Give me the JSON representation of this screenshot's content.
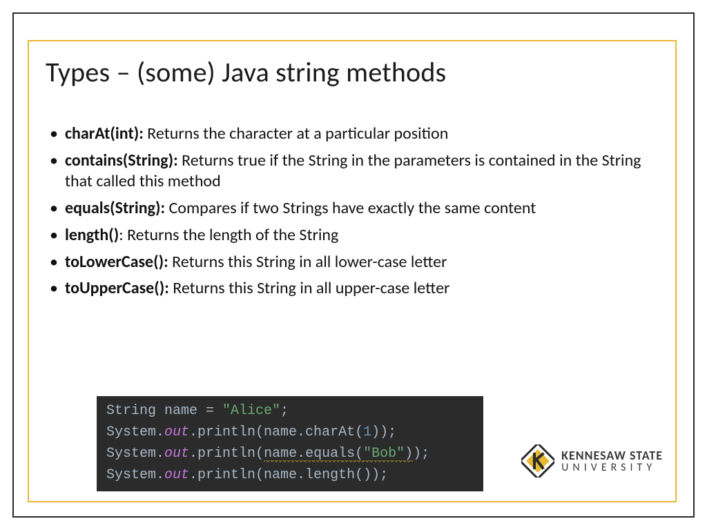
{
  "title": "Types – (some) Java string methods",
  "bullets": [
    {
      "term": "charAt(int):",
      "desc": " Returns the character at a particular position"
    },
    {
      "term": "contains(String):",
      "desc": " Returns true if the String in the parameters is contained in the String that called this method"
    },
    {
      "term": "equals(String):",
      "desc": " Compares if two Strings have exactly the same content"
    },
    {
      "term": "length()",
      "desc": ": Returns the length of the String"
    },
    {
      "term": "toLowerCase():",
      "desc": " Returns this String in all lower-case letter"
    },
    {
      "term": "toUpperCase():",
      "desc": " Returns this String in all upper-case letter"
    }
  ],
  "code": {
    "line1_a": "String name = ",
    "line1_str": "\"Alice\"",
    "line1_b": ";",
    "line2_a": "System.",
    "line2_out": "out",
    "line2_b": ".println(name.charAt(",
    "line2_num": "1",
    "line2_c": "));",
    "line3_a": "System.",
    "line3_out": "out",
    "line3_b": ".println(",
    "line3_squig": "name.equals(",
    "line3_str": "\"Bob\"",
    "line3_squig2": ")",
    "line3_c": ");",
    "line4_a": "System.",
    "line4_out": "out",
    "line4_b": ".println(name.length());"
  },
  "logo": {
    "line1": "KENNESAW STATE",
    "line2": "UNIVERSITY"
  }
}
